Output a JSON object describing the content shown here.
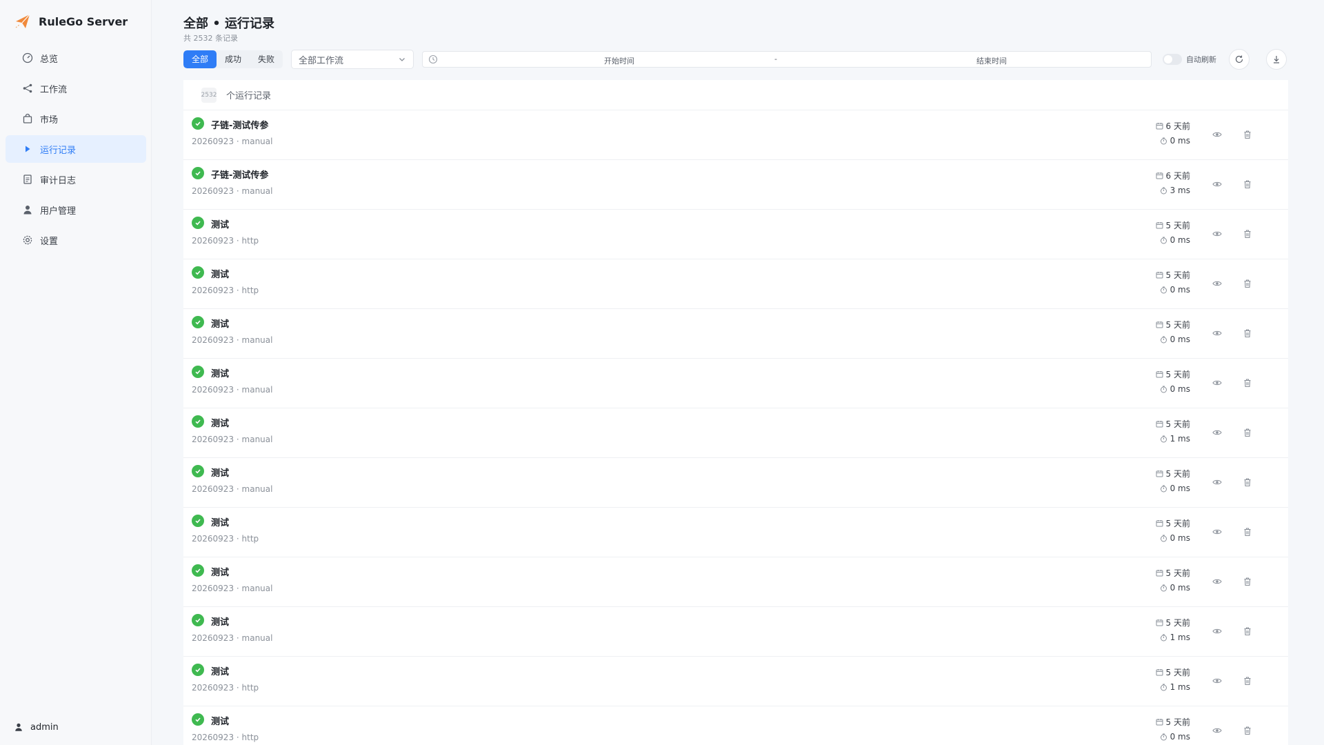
{
  "app": {
    "name": "RuleGo Server"
  },
  "sidebar": {
    "items": [
      {
        "label": "总览",
        "icon": "dashboard-icon",
        "active": false
      },
      {
        "label": "工作流",
        "icon": "share-icon",
        "active": false
      },
      {
        "label": "市场",
        "icon": "shopping-bag-icon",
        "active": false
      },
      {
        "label": "运行记录",
        "icon": "play-icon",
        "active": true
      },
      {
        "label": "审计日志",
        "icon": "document-icon",
        "active": false
      },
      {
        "label": "用户管理",
        "icon": "user-icon",
        "active": false
      },
      {
        "label": "设置",
        "icon": "gear-icon",
        "active": false
      }
    ],
    "user": "admin"
  },
  "header": {
    "title": "全部 • 运行记录",
    "subtitle": "共 2532 条记录"
  },
  "filters": {
    "status_tabs": [
      "全部",
      "成功",
      "失败"
    ],
    "active_tab": "全部",
    "workflow_select": "全部工作流",
    "start_placeholder": "开始时间",
    "range_separator": "-",
    "end_placeholder": "结束时间",
    "auto_refresh_label": "自动刷新",
    "auto_refresh_on": false
  },
  "list": {
    "count_badge": "2532",
    "header_label": "个运行记录",
    "rows": [
      {
        "name": "子链-测试传参",
        "meta": "20260923 · manual",
        "when": "6 天前",
        "duration": "0 ms",
        "status": "success"
      },
      {
        "name": "子链-测试传参",
        "meta": "20260923 · manual",
        "when": "6 天前",
        "duration": "3 ms",
        "status": "success"
      },
      {
        "name": "测试",
        "meta": "20260923 · http",
        "when": "5 天前",
        "duration": "0 ms",
        "status": "success"
      },
      {
        "name": "测试",
        "meta": "20260923 · http",
        "when": "5 天前",
        "duration": "0 ms",
        "status": "success"
      },
      {
        "name": "测试",
        "meta": "20260923 · manual",
        "when": "5 天前",
        "duration": "0 ms",
        "status": "success"
      },
      {
        "name": "测试",
        "meta": "20260923 · manual",
        "when": "5 天前",
        "duration": "0 ms",
        "status": "success"
      },
      {
        "name": "测试",
        "meta": "20260923 · manual",
        "when": "5 天前",
        "duration": "1 ms",
        "status": "success"
      },
      {
        "name": "测试",
        "meta": "20260923 · manual",
        "when": "5 天前",
        "duration": "0 ms",
        "status": "success"
      },
      {
        "name": "测试",
        "meta": "20260923 · http",
        "when": "5 天前",
        "duration": "0 ms",
        "status": "success"
      },
      {
        "name": "测试",
        "meta": "20260923 · manual",
        "when": "5 天前",
        "duration": "0 ms",
        "status": "success"
      },
      {
        "name": "测试",
        "meta": "20260923 · manual",
        "when": "5 天前",
        "duration": "1 ms",
        "status": "success"
      },
      {
        "name": "测试",
        "meta": "20260923 · http",
        "when": "5 天前",
        "duration": "1 ms",
        "status": "success"
      },
      {
        "name": "测试",
        "meta": "20260923 · http",
        "when": "5 天前",
        "duration": "0 ms",
        "status": "success"
      }
    ]
  },
  "colors": {
    "accent": "#2f7df6",
    "success": "#3fb950"
  }
}
